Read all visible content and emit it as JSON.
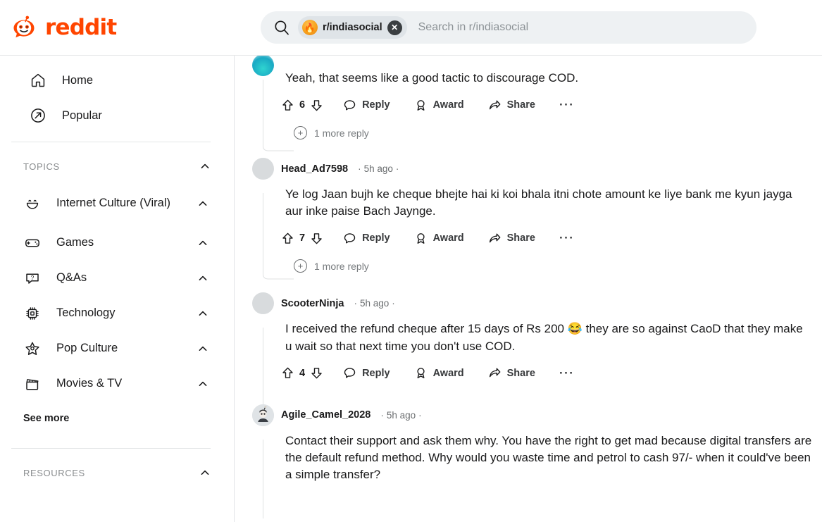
{
  "brand": {
    "name": "reddit",
    "color": "#ff4500"
  },
  "search": {
    "placeholder": "Search in r/indiasocial",
    "value": "",
    "chip_label": "r/indiasocial",
    "chip_icon": "subreddit-avatar",
    "search_icon": "search-icon",
    "clear_icon": "close-icon"
  },
  "sidebar": {
    "nav": [
      {
        "label": "Home",
        "icon": "home-icon"
      },
      {
        "label": "Popular",
        "icon": "trending-arrow-icon"
      }
    ],
    "topics_section": {
      "title": "TOPICS",
      "chevron": "chevron-up-icon"
    },
    "topics": [
      {
        "label": "Internet Culture (Viral)",
        "icon": "smiley-face-icon",
        "chevron": "chevron-up-icon"
      },
      {
        "label": "Games",
        "icon": "gamepad-icon",
        "chevron": "chevron-up-icon"
      },
      {
        "label": "Q&As",
        "icon": "question-bubble-icon",
        "chevron": "chevron-up-icon"
      },
      {
        "label": "Technology",
        "icon": "chip-icon",
        "chevron": "chevron-up-icon"
      },
      {
        "label": "Pop Culture",
        "icon": "star-icon",
        "chevron": "chevron-up-icon"
      },
      {
        "label": "Movies & TV",
        "icon": "clapperboard-icon",
        "chevron": "chevron-up-icon"
      }
    ],
    "see_more": "See more",
    "resources_section": {
      "title": "RESOURCES",
      "chevron": "chevron-up-icon"
    }
  },
  "actions_labels": {
    "reply": "Reply",
    "award": "Award",
    "share": "Share",
    "more": "···",
    "upvote_icon": "upvote-arrow-icon",
    "downvote_icon": "downvote-arrow-icon",
    "reply_icon": "comment-bubble-icon",
    "award_icon": "award-medal-icon",
    "share_icon": "share-arrow-icon"
  },
  "comments": [
    {
      "id": "c0",
      "username": "",
      "timestamp": "",
      "body": "Yeah, that seems like a good tactic to discourage COD.",
      "score": "6",
      "more_reply": "1 more reply",
      "avatar_style": "teal-snoo",
      "partial": true
    },
    {
      "id": "c1",
      "username": "Head_Ad7598",
      "timestamp": "5h ago",
      "body": "Ye log Jaan bujh ke cheque bhejte hai ki koi bhala itni chote amount ke liye bank me kyun jayga aur inke paise Bach Jaynge.",
      "score": "7",
      "more_reply": "1 more reply",
      "avatar_style": "cat-photo"
    },
    {
      "id": "c2",
      "username": "ScooterNinja",
      "timestamp": "5h ago",
      "body_part1": "I received the refund cheque after 15 days of Rs 200 ",
      "emoji": "😂",
      "body_part2": " they are so against CaoD that they make u wait so that next time you don't use COD.",
      "score": "4",
      "avatar_style": "fire-emblem"
    },
    {
      "id": "c3",
      "username": "Agile_Camel_2028",
      "timestamp": "5h ago",
      "body": "Contact their support and ask them why. You have the right to get mad because digital transfers are the default refund method. Why would you waste time and petrol to cash 97/- when it could've been a simple transfer?",
      "avatar_style": "dark-hair-snoo"
    }
  ]
}
